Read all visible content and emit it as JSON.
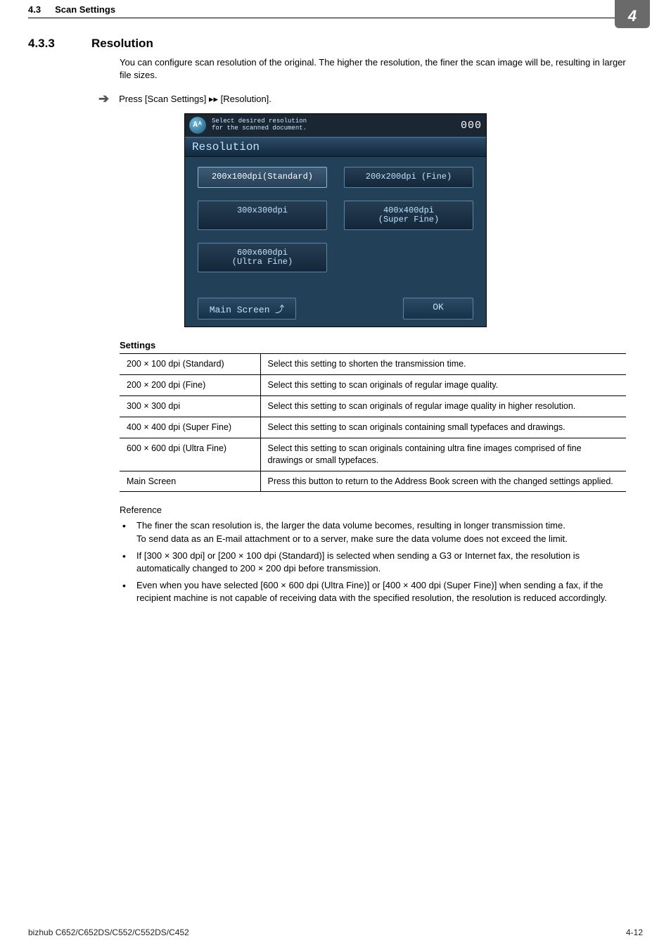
{
  "header": {
    "section_number": "4.3",
    "section_title": "Scan Settings",
    "chapter_badge": "4"
  },
  "section": {
    "number": "4.3.3",
    "title": "Resolution",
    "intro": "You can configure scan resolution of the original. The higher the resolution, the finer the scan image will be, resulting in larger file sizes.",
    "step": "Press [Scan Settings] ▸▸ [Resolution]."
  },
  "screenshot": {
    "icon_text": "Aᴬ",
    "prompt_line1": "Select desired resolution",
    "prompt_line2": "for the scanned document.",
    "counter": "000",
    "title": "Resolution",
    "buttons": {
      "standard": "200x100dpi(Standard)",
      "fine": "200x200dpi (Fine)",
      "r300": "300x300dpi",
      "superfine_l1": "400x400dpi",
      "superfine_l2": "(Super Fine)",
      "ultrafine_l1": "600x600dpi",
      "ultrafine_l2": "(Ultra Fine)"
    },
    "footer": {
      "main": "Main Screen ⤴",
      "ok": "OK"
    }
  },
  "settings_label": "Settings",
  "settings_rows": [
    {
      "label": "200 × 100 dpi (Standard)",
      "desc": "Select this setting to shorten the transmission time."
    },
    {
      "label": "200 × 200 dpi (Fine)",
      "desc": "Select this setting to scan originals of regular image quality."
    },
    {
      "label": "300 × 300 dpi",
      "desc": "Select this setting to scan originals of regular image quality in higher resolution."
    },
    {
      "label": "400 × 400 dpi (Super Fine)",
      "desc": "Select this setting to scan originals containing small typefaces and drawings."
    },
    {
      "label": "600 × 600 dpi (Ultra Fine)",
      "desc": "Select this setting to scan originals containing ultra fine images comprised of fine drawings or small typefaces."
    },
    {
      "label": "Main Screen",
      "desc": "Press this button to return to the Address Book screen with the changed settings applied."
    }
  ],
  "reference_label": "Reference",
  "reference_items": [
    "The finer the scan resolution is, the larger the data volume becomes, resulting in longer transmission time.\nTo send data as an E-mail attachment or to a server, make sure the data volume does not exceed the limit.",
    "If [300 × 300 dpi] or [200 × 100 dpi (Standard)] is selected when sending a G3 or Internet fax, the resolution is automatically changed to 200 × 200 dpi before transmission.",
    "Even when you have selected [600 × 600 dpi (Ultra Fine)] or [400 × 400 dpi (Super Fine)] when sending a fax, if the recipient machine is not capable of receiving data with the specified resolution, the resolution is reduced accordingly."
  ],
  "footer": {
    "model": "bizhub C652/C652DS/C552/C552DS/C452",
    "page": "4-12"
  }
}
